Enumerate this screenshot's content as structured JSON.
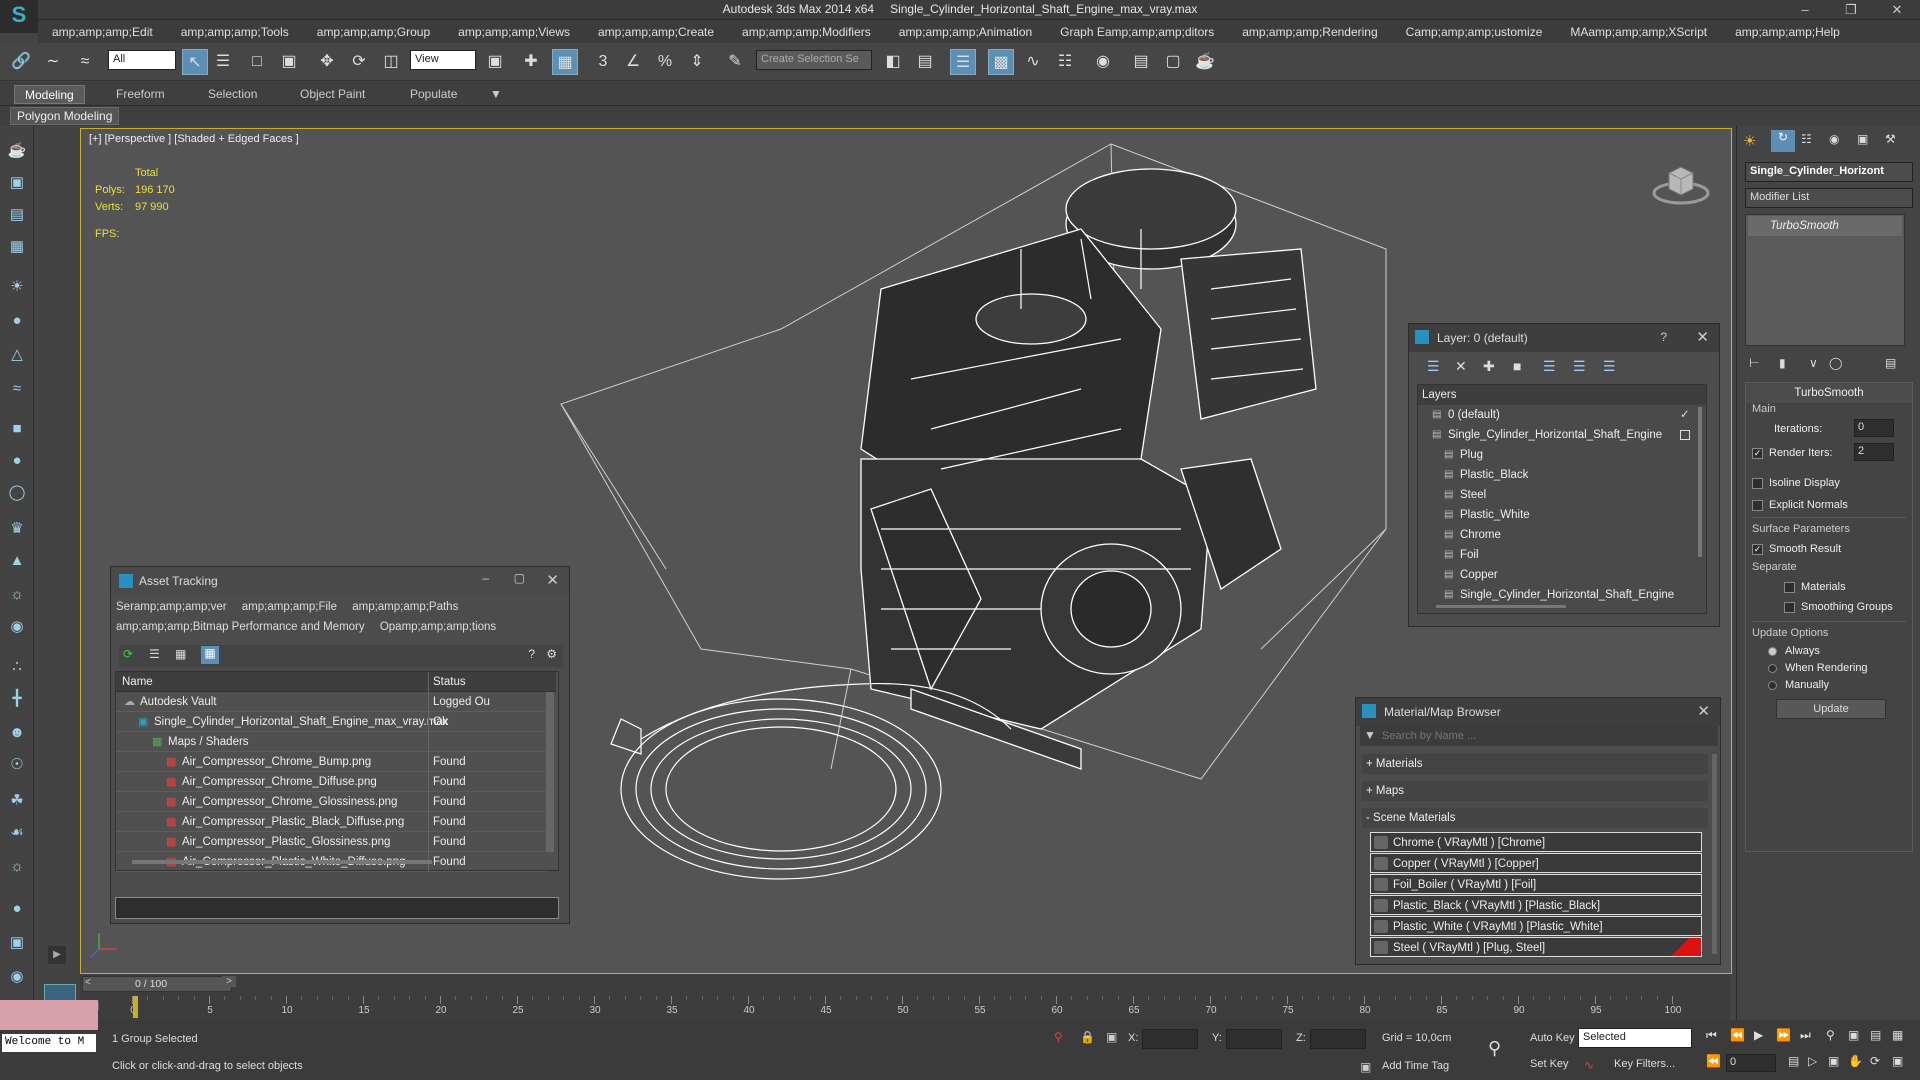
{
  "window": {
    "title": "Autodesk 3ds Max  2014 x64",
    "file": "Single_Cylinder_Horizontal_Shaft_Engine_max_vray.max"
  },
  "menu": [
    "amp;amp;amp;Edit",
    "amp;amp;amp;Tools",
    "amp;amp;amp;Group",
    "amp;amp;amp;Views",
    "amp;amp;amp;Create",
    "amp;amp;amp;Modifiers",
    "amp;amp;amp;Animation",
    "Graph Eamp;amp;amp;ditors",
    "amp;amp;amp;Rendering",
    "Camp;amp;amp;ustomize",
    "MAamp;amp;amp;XScript",
    "amp;amp;amp;Help"
  ],
  "toolbar": {
    "filter_value": "All",
    "ref_coord": "View",
    "selection_set_placeholder": "Create Selection Se"
  },
  "ribbon": {
    "tabs": [
      "Modeling",
      "Freeform",
      "Selection",
      "Object Paint",
      "Populate"
    ],
    "sub_label": "Polygon Modeling"
  },
  "viewport": {
    "label": "[+] [Perspective ] [Shaded + Edged Faces ]",
    "stats": {
      "total_label": "Total",
      "polys_label": "Polys:",
      "polys": "196 170",
      "verts_label": "Verts:",
      "verts": "97 990",
      "fps_label": "FPS:"
    }
  },
  "asset_tracking": {
    "title": "Asset Tracking",
    "menu_row1": [
      "Seramp;amp;amp;ver",
      "amp;amp;amp;File",
      "amp;amp;amp;Paths"
    ],
    "menu_row2": [
      "amp;amp;amp;Bitmap Performance and Memory",
      "Opamp;amp;amp;tions"
    ],
    "columns": [
      "Name",
      "Status"
    ],
    "rows": [
      {
        "name": "Autodesk Vault",
        "status": "Logged Ou",
        "indent": 0
      },
      {
        "name": "Single_Cylinder_Horizontal_Shaft_Engine_max_vray.max",
        "status": "Ok",
        "indent": 1
      },
      {
        "name": "Maps / Shaders",
        "status": "",
        "indent": 2
      },
      {
        "name": "Air_Compressor_Chrome_Bump.png",
        "status": "Found",
        "indent": 3
      },
      {
        "name": "Air_Compressor_Chrome_Diffuse.png",
        "status": "Found",
        "indent": 3
      },
      {
        "name": "Air_Compressor_Chrome_Glossiness.png",
        "status": "Found",
        "indent": 3
      },
      {
        "name": "Air_Compressor_Plastic_Black_Diffuse.png",
        "status": "Found",
        "indent": 3
      },
      {
        "name": "Air_Compressor_Plastic_Glossiness.png",
        "status": "Found",
        "indent": 3
      },
      {
        "name": "Air_Compressor_Plastic_White_Diffuse.png",
        "status": "Found",
        "indent": 3
      }
    ]
  },
  "layers": {
    "title": "Layer: 0 (default)",
    "help": "?",
    "header": "Layers",
    "items": [
      {
        "name": "0 (default)",
        "indent": 0
      },
      {
        "name": "Single_Cylinder_Horizontal_Shaft_Engine",
        "indent": 0
      },
      {
        "name": "Plug",
        "indent": 1
      },
      {
        "name": "Plastic_Black",
        "indent": 1
      },
      {
        "name": "Steel",
        "indent": 1
      },
      {
        "name": "Plastic_White",
        "indent": 1
      },
      {
        "name": "Chrome",
        "indent": 1
      },
      {
        "name": "Foil",
        "indent": 1
      },
      {
        "name": "Copper",
        "indent": 1
      },
      {
        "name": "Single_Cylinder_Horizontal_Shaft_Engine",
        "indent": 1
      }
    ]
  },
  "material_browser": {
    "title": "Material/Map Browser",
    "search_placeholder": "Search by Name ...",
    "groups": [
      "+ Materials",
      "+ Maps",
      "- Scene Materials"
    ],
    "materials": [
      "Chrome  ( VRayMtl ) [Chrome]",
      "Copper  ( VRayMtl ) [Copper]",
      "Foil_Boiler  ( VRayMtl ) [Foil]",
      "Plastic_Black  ( VRayMtl ) [Plastic_Black]",
      "Plastic_White  ( VRayMtl ) [Plastic_White]",
      "Steel  ( VRayMtl ) [Plug, Steel]"
    ]
  },
  "command_panel": {
    "object_name": "Single_Cylinder_Horizont",
    "modifier_list": "Modifier List",
    "stack_item": "TurboSmooth",
    "rollout_title": "TurboSmooth",
    "main_label": "Main",
    "iterations_label": "Iterations:",
    "iterations": "0",
    "render_iters_label": "Render Iters:",
    "render_iters": "2",
    "isoline": "Isoline Display",
    "explicit": "Explicit Normals",
    "surface_label": "Surface Parameters",
    "smooth_result": "Smooth Result",
    "separate_label": "Separate",
    "materials": "Materials",
    "smoothing_groups": "Smoothing Groups",
    "update_options_label": "Update Options",
    "always": "Always",
    "when_rendering": "When Rendering",
    "manually": "Manually",
    "update_button": "Update"
  },
  "timeline": {
    "frame": "0 / 100",
    "ticks": [
      "0",
      "5",
      "10",
      "15",
      "20",
      "25",
      "30",
      "35",
      "40",
      "45",
      "50",
      "55",
      "60",
      "65",
      "70",
      "75",
      "80",
      "85",
      "90",
      "95",
      "100"
    ]
  },
  "status": {
    "welcome": "Welcome to M",
    "selected": "1 Group Selected",
    "prompt": "Click or click-and-drag to select objects",
    "x_label": "X:",
    "y_label": "Y:",
    "z_label": "Z:",
    "grid": "Grid = 10,0cm",
    "auto_key": "Auto Key",
    "set_key": "Set Key",
    "selected_mode": "Selected",
    "key_filters": "Key Filters...",
    "add_time_tag": "Add Time Tag",
    "frame_field": "0"
  },
  "colors": {
    "accent": "#5c8fb5",
    "viewport_border": "#c8b020",
    "stats": "#e8e040",
    "viewport_bg": "#545454"
  }
}
